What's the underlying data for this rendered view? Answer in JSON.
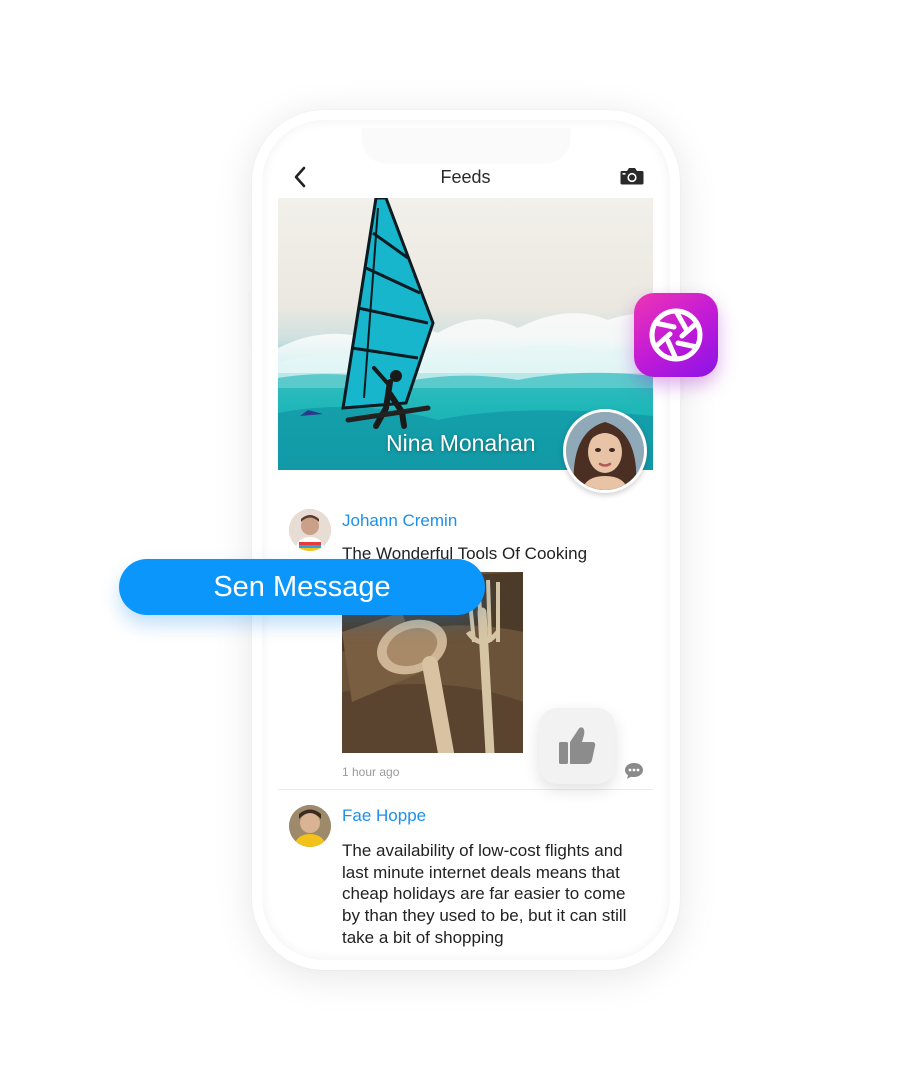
{
  "header": {
    "title": "Feeds",
    "back_icon": "chevron-left-icon",
    "camera_icon": "camera-icon"
  },
  "hero": {
    "name": "Nina Monahan"
  },
  "posts": [
    {
      "author": "Johann Cremin",
      "text": "The Wonderful Tools Of Cooking",
      "time": "1 hour ago"
    },
    {
      "author": "Fae Hoppe",
      "text": "The availability of low-cost flights and last minute internet deals means that cheap holidays are far easier to come by than they used to be, but it can still take a bit of shopping"
    }
  ],
  "floating": {
    "send_label": "Sen Message",
    "app_icon": "shutter-icon",
    "like_icon": "thumbs-up-icon",
    "comment_icon": "chat-bubble-icon"
  },
  "colors": {
    "accent": "#0a96fb",
    "author": "#1e90e8",
    "app_gradient_start": "#ee35b4",
    "app_gradient_end": "#8a13e6"
  }
}
